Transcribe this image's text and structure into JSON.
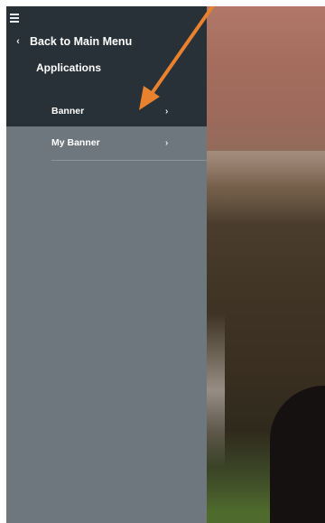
{
  "sidebar": {
    "menu_icon": "hamburger-menu-icon",
    "back": {
      "icon": "chevron-left-icon",
      "label": "Back to Main Menu"
    },
    "section_title": "Applications",
    "items": [
      {
        "label": "Banner",
        "icon": "chevron-right-icon",
        "active": true
      },
      {
        "label": "My Banner",
        "icon": "chevron-right-icon",
        "active": false
      }
    ]
  },
  "annotation": {
    "type": "arrow",
    "color": "#e9822e",
    "points_to": "Banner"
  },
  "colors": {
    "sidebar_dark": "#283137",
    "sidebar_light": "#6e777d",
    "text": "#ffffff"
  }
}
